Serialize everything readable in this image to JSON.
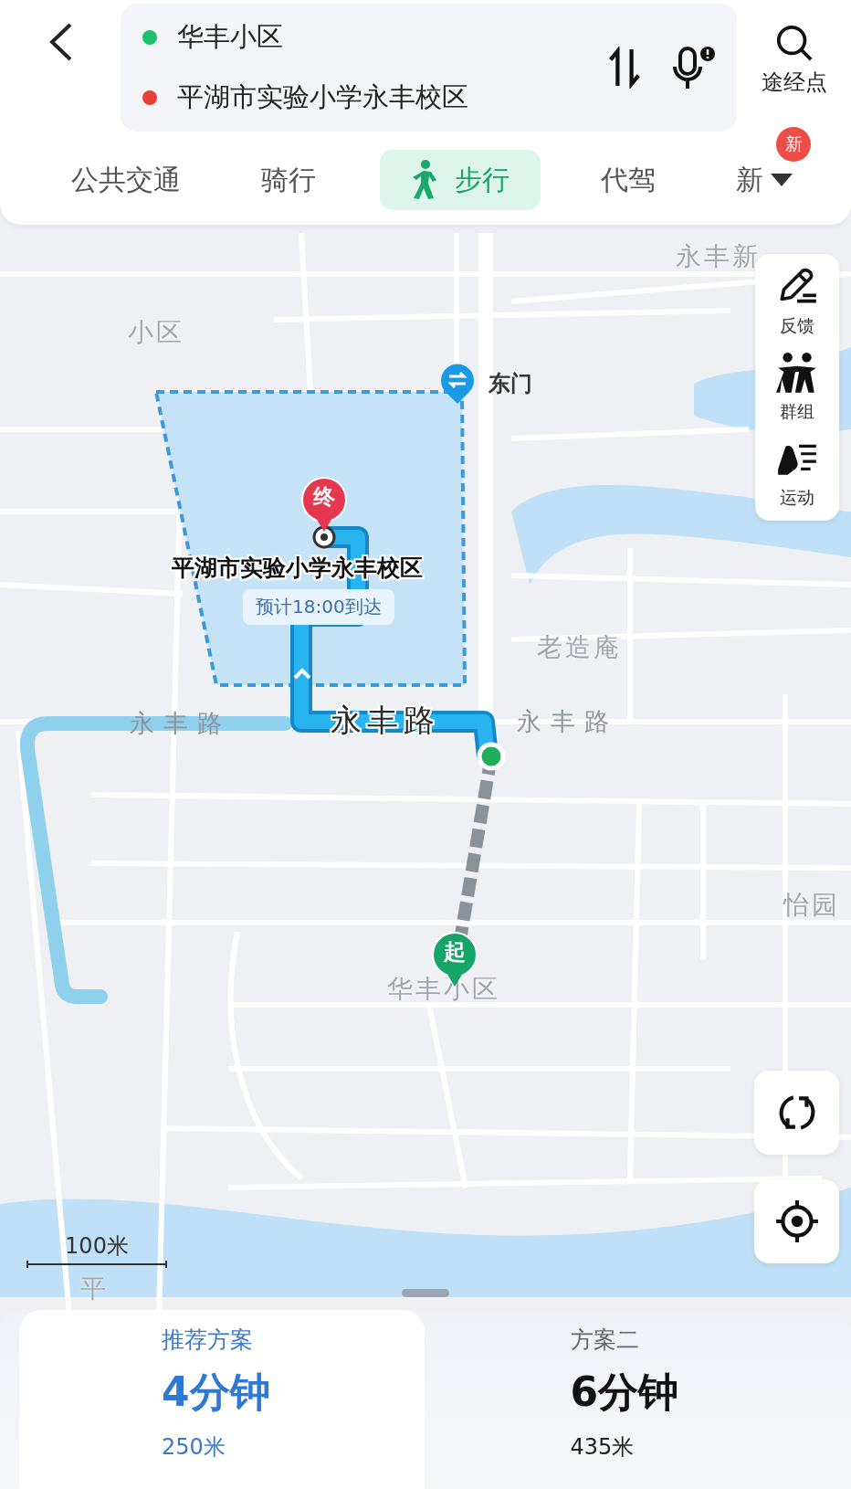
{
  "route_fields": {
    "origin": "华丰小区",
    "destination": "平湖市实验小学永丰校区",
    "waypoint_label": "途经点"
  },
  "mode_tabs": [
    {
      "label": "公共交通",
      "selected": false
    },
    {
      "label": "骑行",
      "selected": false
    },
    {
      "label": "步行",
      "selected": true
    },
    {
      "label": "代驾",
      "selected": false
    },
    {
      "label": "新",
      "selected": false
    }
  ],
  "more_badge": "新",
  "map": {
    "labels": [
      {
        "text": "永丰新",
        "kind": "area"
      },
      {
        "text": "小区",
        "kind": "area"
      },
      {
        "text": "老造庵",
        "kind": "area"
      },
      {
        "text": "怡园",
        "kind": "area"
      },
      {
        "text": "华丰小区",
        "kind": "area"
      },
      {
        "text": "平",
        "kind": "area"
      },
      {
        "text": "永丰路",
        "kind": "road"
      },
      {
        "text": "永丰路",
        "kind": "road-major"
      },
      {
        "text": "永丰路",
        "kind": "road"
      }
    ],
    "gate": "东门",
    "destination_name": "平湖市实验小学永丰校区",
    "eta": "预计18:00到达",
    "end_marker": "终",
    "start_marker": "起",
    "scale": "100米"
  },
  "map_tools": [
    {
      "label": "反馈",
      "kind": "feedback"
    },
    {
      "label": "群组",
      "kind": "group"
    },
    {
      "label": "运动",
      "kind": "sport"
    }
  ],
  "plans": [
    {
      "title": "推荐方案",
      "duration": "4分钟",
      "distance": "250米",
      "selected": true
    },
    {
      "title": "方案二",
      "duration": "6分钟",
      "distance": "435米",
      "selected": false
    }
  ]
}
